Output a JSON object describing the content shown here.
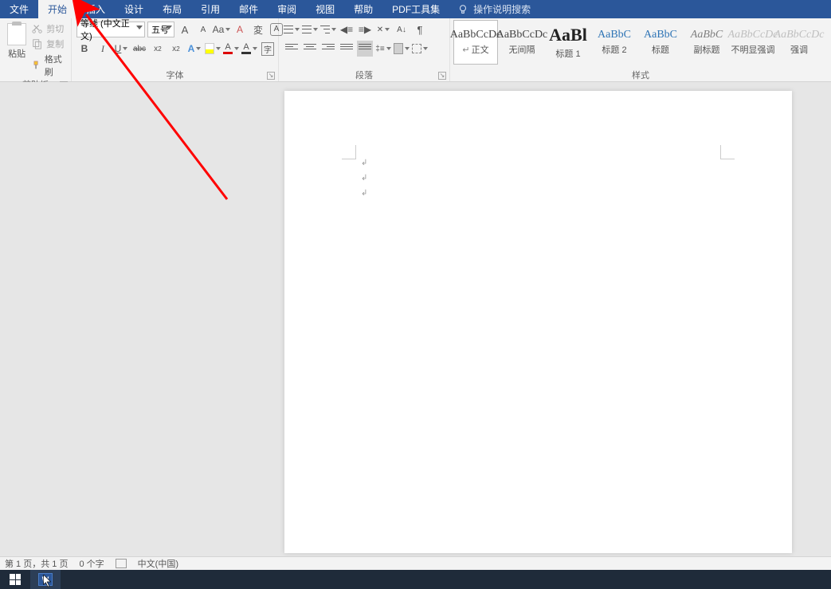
{
  "menu": {
    "tabs": [
      "文件",
      "开始",
      "插入",
      "设计",
      "布局",
      "引用",
      "邮件",
      "审阅",
      "视图",
      "帮助",
      "PDF工具集"
    ],
    "active_index": 1,
    "search_placeholder": "操作说明搜索"
  },
  "clipboard": {
    "paste": "粘贴",
    "cut": "剪切",
    "copy": "复制",
    "format_painter": "格式刷",
    "group": "剪贴板"
  },
  "font": {
    "font_name": "等线 (中文正文)",
    "font_size": "五号",
    "group": "字体",
    "bold": "B",
    "italic": "I",
    "underline": "U",
    "strike": "abc",
    "sub": "x₂",
    "sup": "x²",
    "aa": "Aa",
    "bigA": "A",
    "smallA": "A",
    "clear": "A",
    "pinyin": "拼",
    "border_char": "字",
    "hlA": "A",
    "fcA": "A",
    "fillA": "A",
    "circA": "A"
  },
  "paragraph": {
    "group": "段落"
  },
  "styles": {
    "group": "样式",
    "items": [
      {
        "preview": "AaBbCcDc",
        "label": "正文",
        "selected": true,
        "cls": ""
      },
      {
        "preview": "AaBbCcDc",
        "label": "无间隔",
        "selected": false,
        "cls": ""
      },
      {
        "preview": "AaBl",
        "label": "标题 1",
        "selected": false,
        "cls": "big"
      },
      {
        "preview": "AaBbC",
        "label": "标题 2",
        "selected": false,
        "cls": "heading"
      },
      {
        "preview": "AaBbC",
        "label": "标题",
        "selected": false,
        "cls": "heading"
      },
      {
        "preview": "AaBbC",
        "label": "副标题",
        "selected": false,
        "cls": "sub"
      },
      {
        "preview": "AaBbCcDc",
        "label": "不明显强调",
        "selected": false,
        "cls": "dim"
      },
      {
        "preview": "AaBbCcDc",
        "label": "强调",
        "selected": false,
        "cls": "dim"
      }
    ]
  },
  "status": {
    "page": "第 1 页，共 1 页",
    "words": "0 个字",
    "lang": "中文(中国)"
  }
}
